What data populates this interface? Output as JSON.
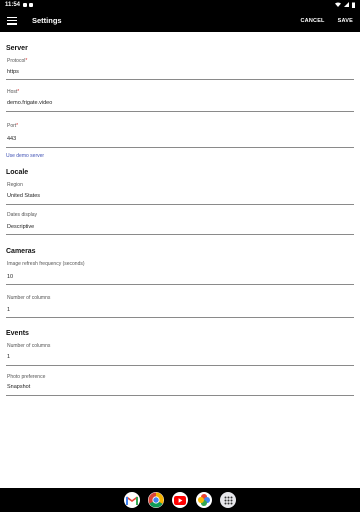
{
  "status": {
    "time": "11:54"
  },
  "app_bar": {
    "title": "Settings",
    "cancel": "CANCEL",
    "save": "SAVE"
  },
  "server": {
    "title": "Server",
    "protocol": {
      "label": "Protocol",
      "required": "*",
      "value": "https"
    },
    "host": {
      "label": "Host",
      "required": "*",
      "value": "demo.frigate.video"
    },
    "port": {
      "label": "Port",
      "required": "*",
      "value": "443"
    },
    "demo_link": "Use demo server"
  },
  "locale": {
    "title": "Locale",
    "region": {
      "label": "Region",
      "value": "United States"
    },
    "dates": {
      "label": "Dates display",
      "value": "Descriptive"
    }
  },
  "cameras": {
    "title": "Cameras",
    "refresh": {
      "label": "Image refresh frequency (seconds)",
      "value": "10"
    },
    "columns": {
      "label": "Number of columns",
      "value": "1"
    }
  },
  "events": {
    "title": "Events",
    "columns": {
      "label": "Number of columns",
      "value": "1"
    },
    "photo": {
      "label": "Photo preference",
      "value": "Snapshot"
    }
  },
  "dock": {
    "icons": [
      "gmail-icon",
      "chrome-icon",
      "youtube-icon",
      "photos-icon",
      "app-drawer-icon"
    ]
  }
}
